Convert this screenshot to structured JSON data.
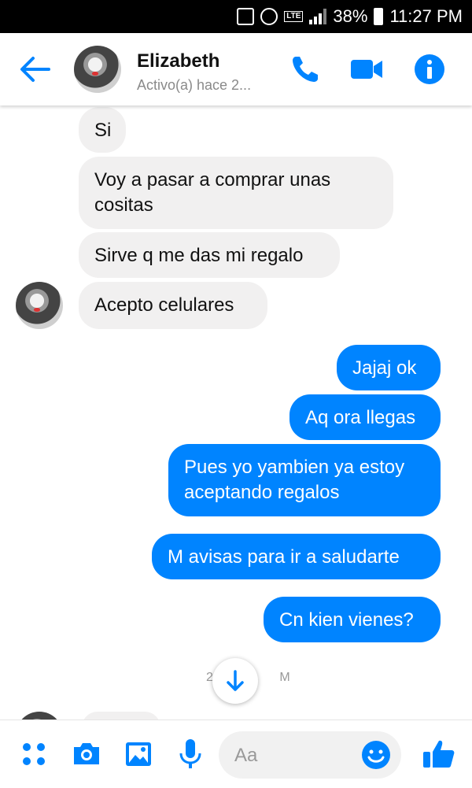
{
  "status_bar": {
    "battery": "38%",
    "time": "11:27 PM",
    "network": "LTE"
  },
  "header": {
    "contact_name": "Elizabeth",
    "contact_status": "Activo(a) hace 2...",
    "icons": [
      "back-arrow-icon",
      "phone-icon",
      "video-icon",
      "info-icon"
    ],
    "accent_color": "#0084ff"
  },
  "messages": [
    {
      "sender": "contact",
      "text": "Si"
    },
    {
      "sender": "contact",
      "text": "Voy a pasar a comprar unas cositas"
    },
    {
      "sender": "contact",
      "text": "Sirve q me das mi regalo"
    },
    {
      "sender": "contact",
      "text": "Acepto celulares"
    },
    {
      "sender": "me",
      "text": "Jajaj ok"
    },
    {
      "sender": "me",
      "text": "Aq ora llegas"
    },
    {
      "sender": "me",
      "text": "Pues yo yambien ya estoy aceptando regalos"
    },
    {
      "sender": "me",
      "text": "M avisas para ir a saludarte"
    },
    {
      "sender": "me",
      "text": "Cn kien vienes?"
    }
  ],
  "timestamp_partial": "2 M",
  "composer": {
    "placeholder": "Aa",
    "icons": [
      "apps-icon",
      "camera-icon",
      "gallery-icon",
      "microphone-icon",
      "emoji-icon",
      "like-icon"
    ]
  },
  "colors": {
    "incoming_bubble": "#f1f0f0",
    "outgoing_bubble": "#0084ff"
  }
}
